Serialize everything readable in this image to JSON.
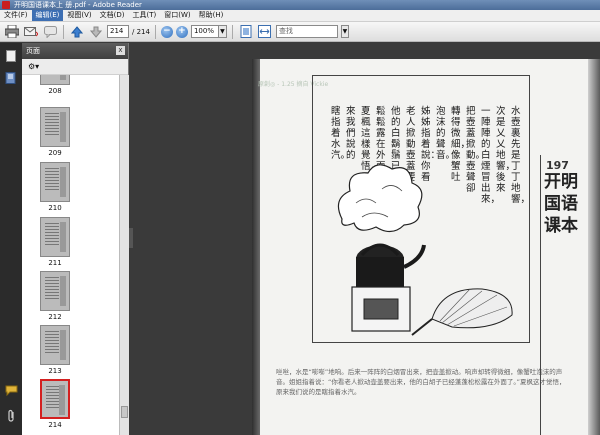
{
  "window": {
    "title": "开明国语课本上 册.pdf - Adobe Reader"
  },
  "menu": {
    "items": [
      "文件(F)",
      "编辑(E)",
      "视图(V)",
      "文档(D)",
      "工具(T)",
      "窗口(W)",
      "帮助(H)"
    ],
    "active_index": 1
  },
  "toolbar": {
    "page_current": "214",
    "page_total": "/ 214",
    "zoom": "100%",
    "search_placeholder": "查找"
  },
  "panel": {
    "title": "页面",
    "close_label": "x",
    "options_label": "⚙▾",
    "thumbnails": [
      {
        "label": "208"
      },
      {
        "label": "209"
      },
      {
        "label": "210"
      },
      {
        "label": "211"
      },
      {
        "label": "212"
      },
      {
        "label": "213"
      },
      {
        "label": "214"
      }
    ],
    "selected_label": "214"
  },
  "document": {
    "watermark": "原創◎ - 1.25 摘自 Vickie",
    "columns": [
      "水壺裏先是丁丁地響，",
      "次是乂乂地響，後來",
      "一陣陣的白煙冒出來，",
      "把壺蓋掀動。壺聲卻",
      "轉得微細，像蟹吐",
      "泡沫的聲音。",
      "姊姊指着說：你看",
      "老人掀動壺蓋要出來。",
      "他的白鬍鬚已經蓬蓬",
      "鬆鬆露在外面了。",
      "夏楓這樣覺悟，原",
      "來我們說的",
      "瞎指着水汽。"
    ],
    "caption": "咝咝，水是“嘭嘭”地响。后来一阵阵的白烟冒出来，把壶盖掀动。响声却转得微细，像蟹吐泡沫的声音。姐姐指着说：“你看老人掀动壶盖要出来，他的白胡子已经蓬蓬松松露在外面了。”夏枫这才觉悟，原来我们说的是瞎指着水汽。",
    "right_year": "197",
    "right_title": "开明国语课本"
  }
}
